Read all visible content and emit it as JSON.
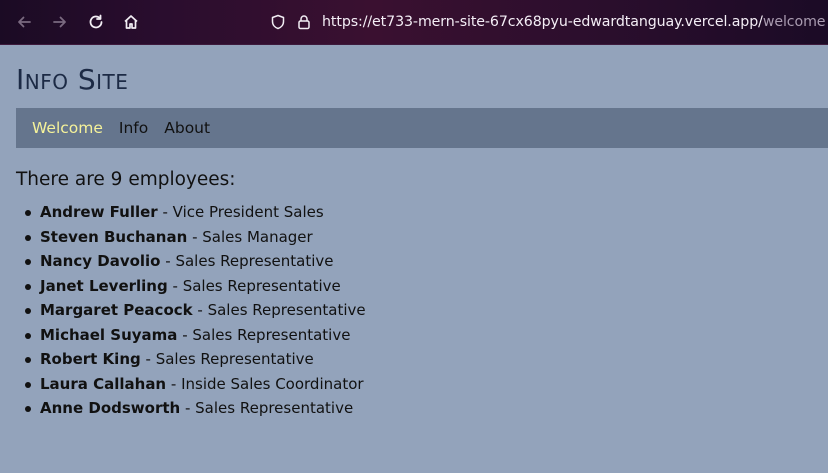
{
  "browser": {
    "url_main": "https://et733-mern-site-67cx68pyu-edwardtanguay.vercel.app/",
    "url_path": "welcome",
    "icons": [
      "back-icon",
      "forward-icon",
      "reload-icon",
      "home-icon",
      "shield-icon",
      "lock-icon"
    ]
  },
  "site": {
    "title": "Info Site",
    "nav": [
      {
        "label": "Welcome",
        "active": true
      },
      {
        "label": "Info",
        "active": false
      },
      {
        "label": "About",
        "active": false
      }
    ]
  },
  "content": {
    "count_text": "There are 9 employees:",
    "employees": [
      {
        "name": "Andrew Fuller",
        "title": "Vice President Sales"
      },
      {
        "name": "Steven Buchanan",
        "title": "Sales Manager"
      },
      {
        "name": "Nancy Davolio",
        "title": "Sales Representative"
      },
      {
        "name": "Janet Leverling",
        "title": "Sales Representative"
      },
      {
        "name": "Margaret Peacock",
        "title": "Sales Representative"
      },
      {
        "name": "Michael Suyama",
        "title": "Sales Representative"
      },
      {
        "name": "Robert King",
        "title": "Sales Representative"
      },
      {
        "name": "Laura Callahan",
        "title": "Inside Sales Coordinator"
      },
      {
        "name": "Anne Dodsworth",
        "title": "Sales Representative"
      }
    ]
  },
  "colors": {
    "page_bg": "#93a3bb",
    "nav_bg": "#65758d",
    "active_link": "#f5f29a",
    "title": "#1c2a45"
  }
}
